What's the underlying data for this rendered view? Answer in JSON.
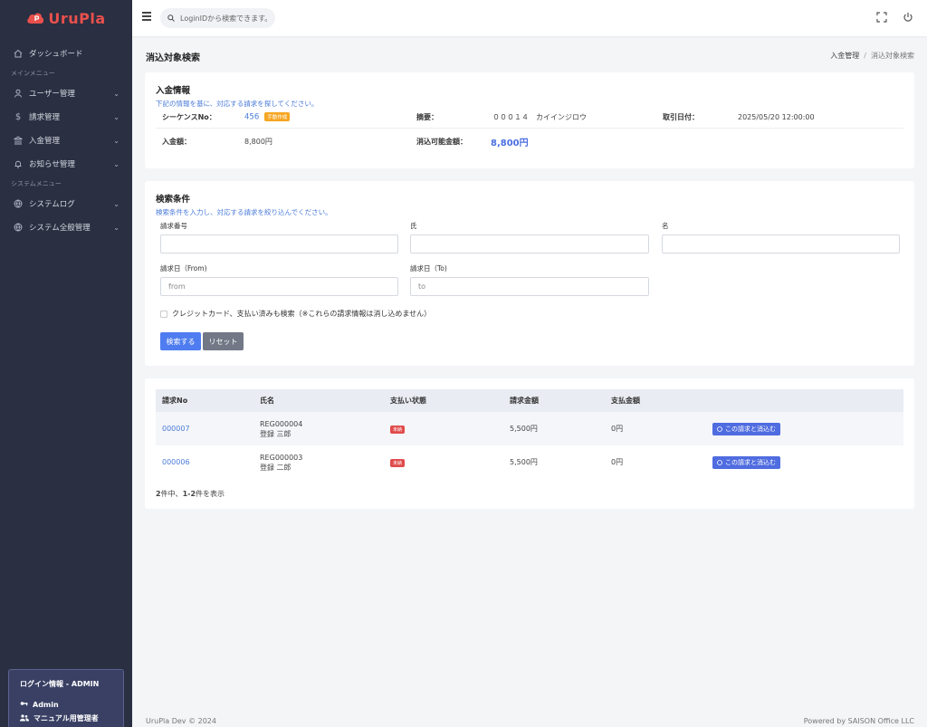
{
  "brand": {
    "name": "UruPla"
  },
  "header": {
    "search_placeholder": "LoginIDから検索できます。"
  },
  "sidebar": {
    "dashboard": "ダッシュボード",
    "section_main": "メインメニュー",
    "main_items": [
      "ユーザー管理",
      "請求管理",
      "入金管理",
      "お知らせ管理"
    ],
    "section_system": "システムメニュー",
    "system_items": [
      "システムログ",
      "システム全般管理"
    ],
    "login": {
      "title": "ログイン情報 - ADMIN",
      "user": "Admin",
      "role": "マニュアル用管理者"
    }
  },
  "page": {
    "title": "消込対象検索",
    "breadcrumb": [
      "入金管理",
      "消込対象検索"
    ]
  },
  "payment_info": {
    "title": "入金情報",
    "subtitle": "下記の情報を基に、対応する請求を探してください。",
    "sequence_label": "シーケンスNo：",
    "sequence_value": "456",
    "sequence_badge": "手動作成",
    "summary_label": "摘要：",
    "summary_value": "０００１４　カイインジロウ",
    "date_label": "取引日付：",
    "date_value": "2025/05/20 12:00:00",
    "amount_label": "入金額：",
    "amount_value": "8,800円",
    "clearable_label": "消込可能金額：",
    "clearable_value": "8,800円"
  },
  "search": {
    "title": "検索条件",
    "subtitle": "検索条件を入力し、対応する請求を絞り込んでください。",
    "invoice_no_label": "請求番号",
    "last_name_label": "氏",
    "first_name_label": "名",
    "date_from_label": "請求日（From)",
    "date_to_label": "請求日（To)",
    "date_from_placeholder": "from",
    "date_to_placeholder": "to",
    "checkbox_label": "クレジットカード、支払い済みも検索（※これらの請求情報は消し込めません）",
    "search_button": "検索する",
    "reset_button": "リセット"
  },
  "results": {
    "columns": [
      "請求No",
      "氏名",
      "支払い状態",
      "請求金額",
      "支払金額",
      ""
    ],
    "rows": [
      {
        "no": "000007",
        "reg": "REG000004",
        "name": "登録 三郎",
        "status": "未納",
        "amount": "5,500円",
        "paid": "0円",
        "action": "この請求と消込む"
      },
      {
        "no": "000006",
        "reg": "REG000003",
        "name": "登録 二郎",
        "status": "未納",
        "amount": "5,500円",
        "paid": "0円",
        "action": "この請求と消込む"
      }
    ],
    "paging": {
      "total": "2",
      "mid": "件中、",
      "range": "1-2",
      "suffix": "件を表示"
    }
  },
  "footer": {
    "left": "UruPla Dev © 2024",
    "right": "Powered by SAISON Office LLC"
  },
  "colors": {
    "sidebar": "#2a2f42",
    "accent": "#4f7cf0",
    "brand": "#e9504c",
    "danger": "#e04b4b",
    "warning": "#f5a623"
  }
}
